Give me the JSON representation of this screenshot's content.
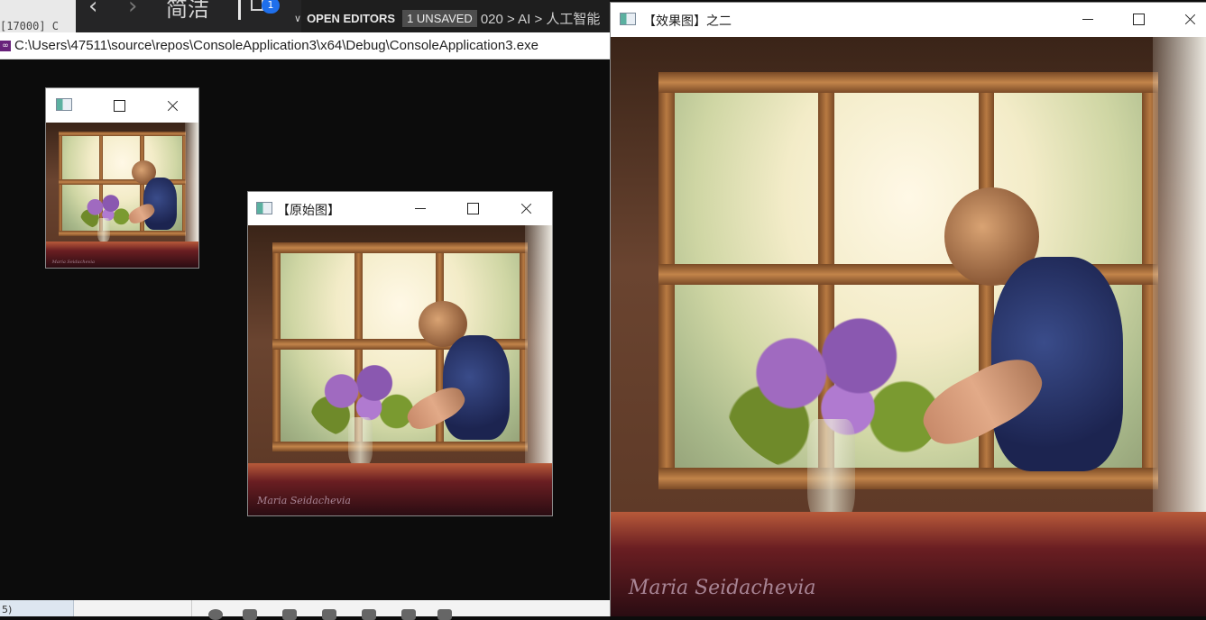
{
  "vscode": {
    "left_fragment": "[17000] C",
    "nav_text": "简洁",
    "badge": "1",
    "open_editors": "OPEN EDITORS",
    "unsaved": "1 UNSAVED",
    "breadcrumb": "020 > AI > 人工智能",
    "status_fragment": "5)"
  },
  "console": {
    "title": "C:\\Users\\47511\\source\\repos\\ConsoleApplication3\\x64\\Debug\\ConsoleApplication3.exe"
  },
  "windows": {
    "small": {
      "title": ""
    },
    "original": {
      "title": "【原始图】"
    },
    "effect": {
      "title": "【效果图】之二"
    }
  },
  "photo": {
    "signature": "Maria Seidachevia"
  }
}
